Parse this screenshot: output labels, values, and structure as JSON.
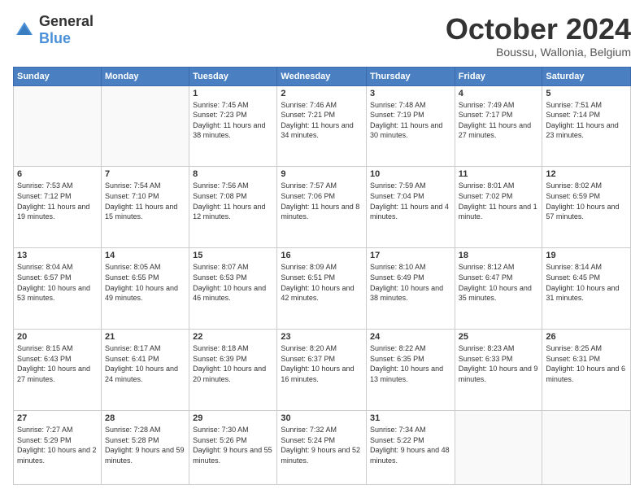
{
  "header": {
    "logo_general": "General",
    "logo_blue": "Blue",
    "month_title": "October 2024",
    "location": "Boussu, Wallonia, Belgium"
  },
  "weekdays": [
    "Sunday",
    "Monday",
    "Tuesday",
    "Wednesday",
    "Thursday",
    "Friday",
    "Saturday"
  ],
  "weeks": [
    [
      {
        "day": "",
        "sunrise": "",
        "sunset": "",
        "daylight": ""
      },
      {
        "day": "",
        "sunrise": "",
        "sunset": "",
        "daylight": ""
      },
      {
        "day": "1",
        "sunrise": "Sunrise: 7:45 AM",
        "sunset": "Sunset: 7:23 PM",
        "daylight": "Daylight: 11 hours and 38 minutes."
      },
      {
        "day": "2",
        "sunrise": "Sunrise: 7:46 AM",
        "sunset": "Sunset: 7:21 PM",
        "daylight": "Daylight: 11 hours and 34 minutes."
      },
      {
        "day": "3",
        "sunrise": "Sunrise: 7:48 AM",
        "sunset": "Sunset: 7:19 PM",
        "daylight": "Daylight: 11 hours and 30 minutes."
      },
      {
        "day": "4",
        "sunrise": "Sunrise: 7:49 AM",
        "sunset": "Sunset: 7:17 PM",
        "daylight": "Daylight: 11 hours and 27 minutes."
      },
      {
        "day": "5",
        "sunrise": "Sunrise: 7:51 AM",
        "sunset": "Sunset: 7:14 PM",
        "daylight": "Daylight: 11 hours and 23 minutes."
      }
    ],
    [
      {
        "day": "6",
        "sunrise": "Sunrise: 7:53 AM",
        "sunset": "Sunset: 7:12 PM",
        "daylight": "Daylight: 11 hours and 19 minutes."
      },
      {
        "day": "7",
        "sunrise": "Sunrise: 7:54 AM",
        "sunset": "Sunset: 7:10 PM",
        "daylight": "Daylight: 11 hours and 15 minutes."
      },
      {
        "day": "8",
        "sunrise": "Sunrise: 7:56 AM",
        "sunset": "Sunset: 7:08 PM",
        "daylight": "Daylight: 11 hours and 12 minutes."
      },
      {
        "day": "9",
        "sunrise": "Sunrise: 7:57 AM",
        "sunset": "Sunset: 7:06 PM",
        "daylight": "Daylight: 11 hours and 8 minutes."
      },
      {
        "day": "10",
        "sunrise": "Sunrise: 7:59 AM",
        "sunset": "Sunset: 7:04 PM",
        "daylight": "Daylight: 11 hours and 4 minutes."
      },
      {
        "day": "11",
        "sunrise": "Sunrise: 8:01 AM",
        "sunset": "Sunset: 7:02 PM",
        "daylight": "Daylight: 11 hours and 1 minute."
      },
      {
        "day": "12",
        "sunrise": "Sunrise: 8:02 AM",
        "sunset": "Sunset: 6:59 PM",
        "daylight": "Daylight: 10 hours and 57 minutes."
      }
    ],
    [
      {
        "day": "13",
        "sunrise": "Sunrise: 8:04 AM",
        "sunset": "Sunset: 6:57 PM",
        "daylight": "Daylight: 10 hours and 53 minutes."
      },
      {
        "day": "14",
        "sunrise": "Sunrise: 8:05 AM",
        "sunset": "Sunset: 6:55 PM",
        "daylight": "Daylight: 10 hours and 49 minutes."
      },
      {
        "day": "15",
        "sunrise": "Sunrise: 8:07 AM",
        "sunset": "Sunset: 6:53 PM",
        "daylight": "Daylight: 10 hours and 46 minutes."
      },
      {
        "day": "16",
        "sunrise": "Sunrise: 8:09 AM",
        "sunset": "Sunset: 6:51 PM",
        "daylight": "Daylight: 10 hours and 42 minutes."
      },
      {
        "day": "17",
        "sunrise": "Sunrise: 8:10 AM",
        "sunset": "Sunset: 6:49 PM",
        "daylight": "Daylight: 10 hours and 38 minutes."
      },
      {
        "day": "18",
        "sunrise": "Sunrise: 8:12 AM",
        "sunset": "Sunset: 6:47 PM",
        "daylight": "Daylight: 10 hours and 35 minutes."
      },
      {
        "day": "19",
        "sunrise": "Sunrise: 8:14 AM",
        "sunset": "Sunset: 6:45 PM",
        "daylight": "Daylight: 10 hours and 31 minutes."
      }
    ],
    [
      {
        "day": "20",
        "sunrise": "Sunrise: 8:15 AM",
        "sunset": "Sunset: 6:43 PM",
        "daylight": "Daylight: 10 hours and 27 minutes."
      },
      {
        "day": "21",
        "sunrise": "Sunrise: 8:17 AM",
        "sunset": "Sunset: 6:41 PM",
        "daylight": "Daylight: 10 hours and 24 minutes."
      },
      {
        "day": "22",
        "sunrise": "Sunrise: 8:18 AM",
        "sunset": "Sunset: 6:39 PM",
        "daylight": "Daylight: 10 hours and 20 minutes."
      },
      {
        "day": "23",
        "sunrise": "Sunrise: 8:20 AM",
        "sunset": "Sunset: 6:37 PM",
        "daylight": "Daylight: 10 hours and 16 minutes."
      },
      {
        "day": "24",
        "sunrise": "Sunrise: 8:22 AM",
        "sunset": "Sunset: 6:35 PM",
        "daylight": "Daylight: 10 hours and 13 minutes."
      },
      {
        "day": "25",
        "sunrise": "Sunrise: 8:23 AM",
        "sunset": "Sunset: 6:33 PM",
        "daylight": "Daylight: 10 hours and 9 minutes."
      },
      {
        "day": "26",
        "sunrise": "Sunrise: 8:25 AM",
        "sunset": "Sunset: 6:31 PM",
        "daylight": "Daylight: 10 hours and 6 minutes."
      }
    ],
    [
      {
        "day": "27",
        "sunrise": "Sunrise: 7:27 AM",
        "sunset": "Sunset: 5:29 PM",
        "daylight": "Daylight: 10 hours and 2 minutes."
      },
      {
        "day": "28",
        "sunrise": "Sunrise: 7:28 AM",
        "sunset": "Sunset: 5:28 PM",
        "daylight": "Daylight: 9 hours and 59 minutes."
      },
      {
        "day": "29",
        "sunrise": "Sunrise: 7:30 AM",
        "sunset": "Sunset: 5:26 PM",
        "daylight": "Daylight: 9 hours and 55 minutes."
      },
      {
        "day": "30",
        "sunrise": "Sunrise: 7:32 AM",
        "sunset": "Sunset: 5:24 PM",
        "daylight": "Daylight: 9 hours and 52 minutes."
      },
      {
        "day": "31",
        "sunrise": "Sunrise: 7:34 AM",
        "sunset": "Sunset: 5:22 PM",
        "daylight": "Daylight: 9 hours and 48 minutes."
      },
      {
        "day": "",
        "sunrise": "",
        "sunset": "",
        "daylight": ""
      },
      {
        "day": "",
        "sunrise": "",
        "sunset": "",
        "daylight": ""
      }
    ]
  ]
}
